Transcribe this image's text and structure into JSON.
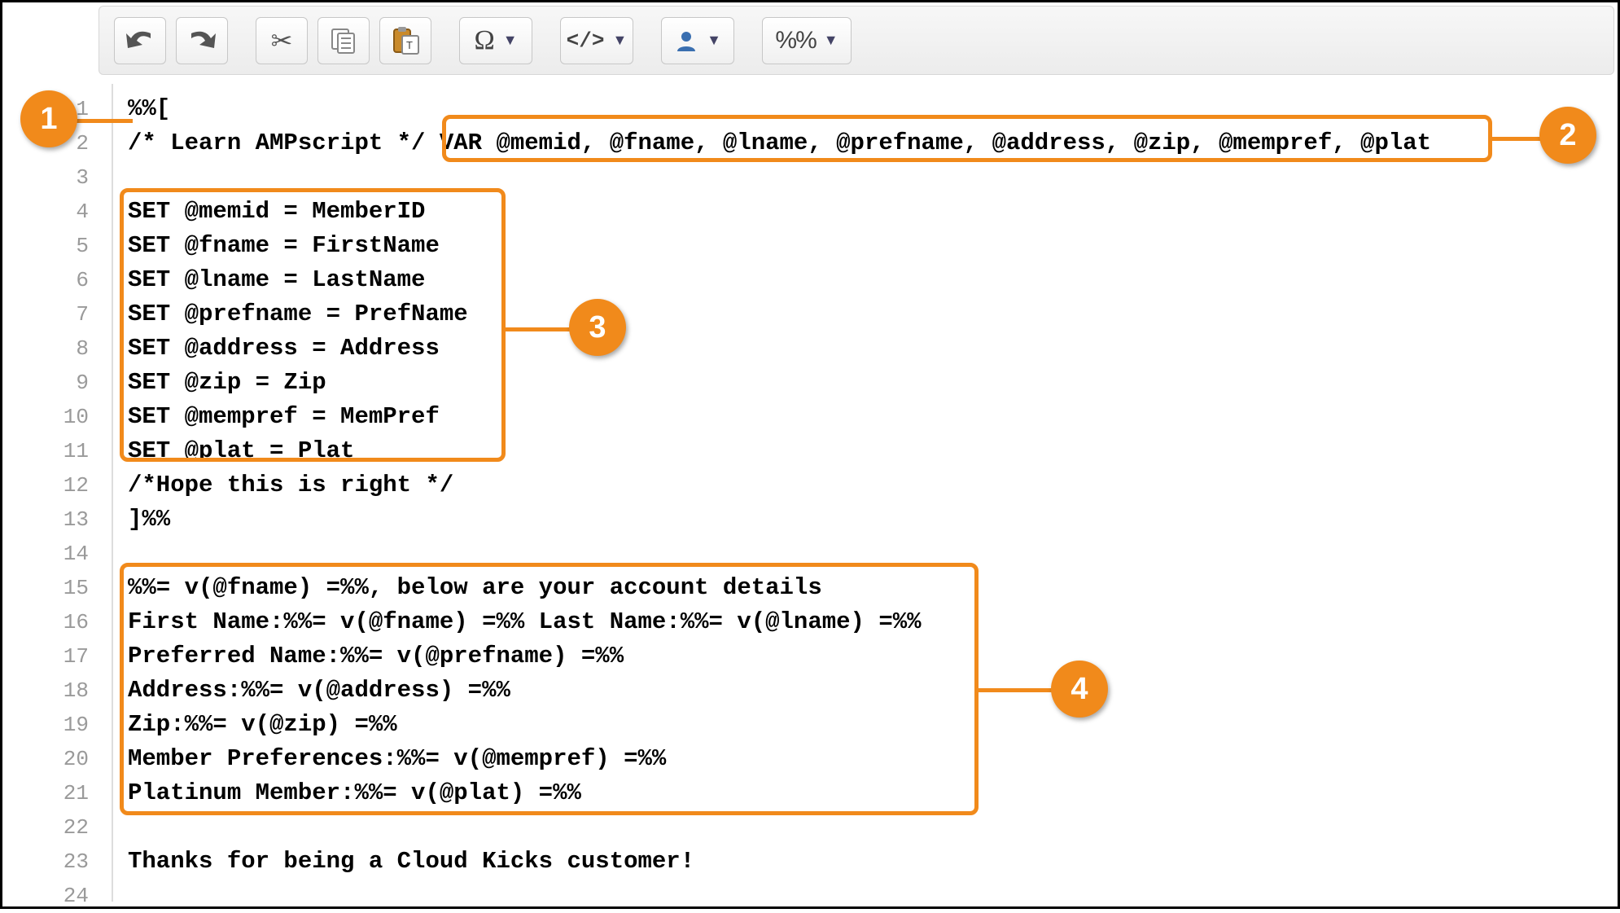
{
  "toolbar": {
    "undo": "↶",
    "redo": "↷",
    "cut": "✂",
    "copy": "📋",
    "omega": "Ω",
    "code_label": "</>",
    "pct_label": "%%"
  },
  "code_lines": [
    "%%[",
    "/* Learn AMPscript */ VAR @memid, @fname, @lname, @prefname, @address, @zip, @mempref, @plat",
    "",
    "SET @memid = MemberID",
    "SET @fname = FirstName",
    "SET @lname = LastName",
    "SET @prefname = PrefName",
    "SET @address = Address",
    "SET @zip = Zip",
    "SET @mempref = MemPref",
    "SET @plat = Plat",
    "/*Hope this is right */",
    "]%%",
    "",
    "%%= v(@fname) =%%, below are your account details",
    "First Name:%%= v(@fname) =%% Last Name:%%= v(@lname) =%%",
    "Preferred Name:%%= v(@prefname) =%%",
    "Address:%%= v(@address) =%%",
    "Zip:%%= v(@zip) =%%",
    "Member Preferences:%%= v(@mempref) =%%",
    "Platinum Member:%%= v(@plat) =%%",
    "",
    "Thanks for being a Cloud Kicks customer!",
    ""
  ],
  "markers": {
    "m1": "1",
    "m2": "2",
    "m3": "3",
    "m4": "4"
  }
}
